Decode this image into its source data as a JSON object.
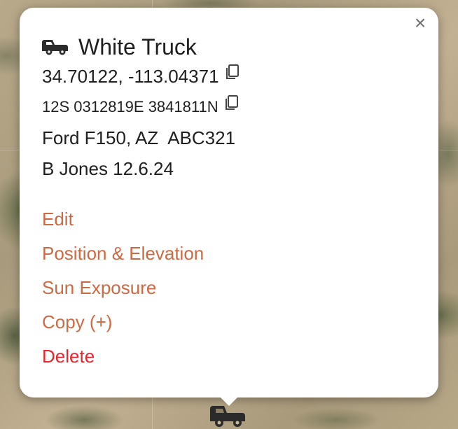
{
  "popup": {
    "title": "White Truck",
    "coordinates": "34.70122, -113.04371",
    "utm": "12S 0312819E 3841811N",
    "vehicle": "Ford F150, AZ  ABC321",
    "note": "B Jones 12.6.24",
    "close_label": "×"
  },
  "actions": {
    "edit": "Edit",
    "position": "Position & Elevation",
    "sun": "Sun Exposure",
    "copy": "Copy (+)",
    "delete": "Delete"
  },
  "icons": {
    "title": "truck-icon",
    "copy": "copy-icon",
    "marker": "truck-marker-icon",
    "close": "close-icon"
  },
  "colors": {
    "action": "#cd6a43",
    "danger": "#e8252c",
    "text": "#1f1f1f"
  }
}
